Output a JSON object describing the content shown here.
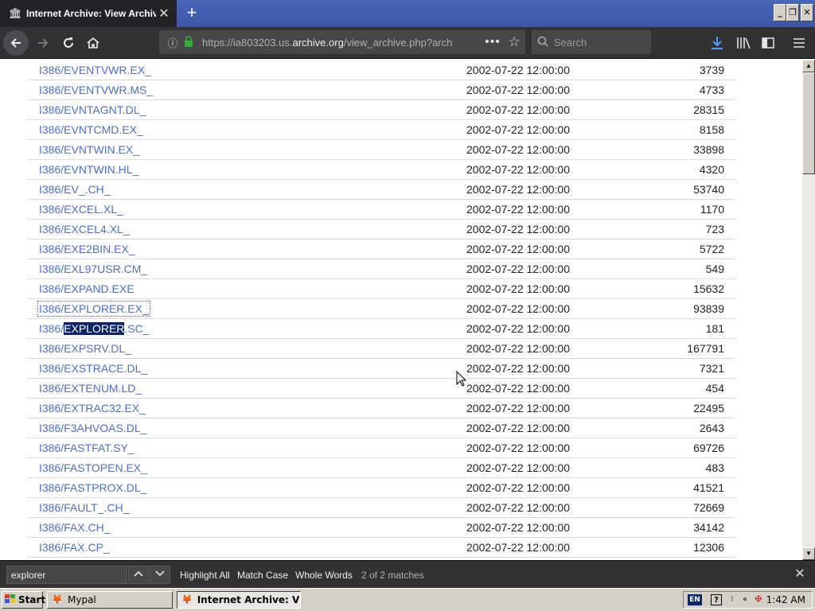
{
  "browser": {
    "tab_title": "Internet Archive: View Archive",
    "tab_close": "✕",
    "new_tab": "+",
    "url_prefix": "https://ia803203.us.",
    "url_domain": "archive.org",
    "url_suffix": "/view_archive.php?arch",
    "search_placeholder": "Search"
  },
  "window_buttons": [
    "_",
    "❐",
    "✕"
  ],
  "files": [
    {
      "name": "I386/EVENTVWR.EX_",
      "date": "2002-07-22 12:00:00",
      "size": "3739"
    },
    {
      "name": "I386/EVENTVWR.MS_",
      "date": "2002-07-22 12:00:00",
      "size": "4733"
    },
    {
      "name": "I386/EVNTAGNT.DL_",
      "date": "2002-07-22 12:00:00",
      "size": "28315"
    },
    {
      "name": "I386/EVNTCMD.EX_",
      "date": "2002-07-22 12:00:00",
      "size": "8158"
    },
    {
      "name": "I386/EVNTWIN.EX_",
      "date": "2002-07-22 12:00:00",
      "size": "33898"
    },
    {
      "name": "I386/EVNTWIN.HL_",
      "date": "2002-07-22 12:00:00",
      "size": "4320"
    },
    {
      "name": "I386/EV_.CH_",
      "date": "2002-07-22 12:00:00",
      "size": "53740"
    },
    {
      "name": "I386/EXCEL.XL_",
      "date": "2002-07-22 12:00:00",
      "size": "1170"
    },
    {
      "name": "I386/EXCEL4.XL_",
      "date": "2002-07-22 12:00:00",
      "size": "723"
    },
    {
      "name": "I386/EXE2BIN.EX_",
      "date": "2002-07-22 12:00:00",
      "size": "5722"
    },
    {
      "name": "I386/EXL97USR.CM_",
      "date": "2002-07-22 12:00:00",
      "size": "549"
    },
    {
      "name": "I386/EXPAND.EXE",
      "date": "2002-07-22 12:00:00",
      "size": "15632"
    },
    {
      "name": "I386/EXPLORER.EX_",
      "date": "2002-07-22 12:00:00",
      "size": "93839",
      "focused": true
    },
    {
      "name": "I386/EXPLORER.SC_",
      "date": "2002-07-22 12:00:00",
      "size": "181",
      "highlight": "EXPLORER"
    },
    {
      "name": "I386/EXPSRV.DL_",
      "date": "2002-07-22 12:00:00",
      "size": "167791"
    },
    {
      "name": "I386/EXSTRACE.DL_",
      "date": "2002-07-22 12:00:00",
      "size": "7321"
    },
    {
      "name": "I386/EXTENUM.LD_",
      "date": "2002-07-22 12:00:00",
      "size": "454"
    },
    {
      "name": "I386/EXTRAC32.EX_",
      "date": "2002-07-22 12:00:00",
      "size": "22495"
    },
    {
      "name": "I386/F3AHVOAS.DL_",
      "date": "2002-07-22 12:00:00",
      "size": "2643"
    },
    {
      "name": "I386/FASTFAT.SY_",
      "date": "2002-07-22 12:00:00",
      "size": "69726"
    },
    {
      "name": "I386/FASTOPEN.EX_",
      "date": "2002-07-22 12:00:00",
      "size": "483"
    },
    {
      "name": "I386/FASTPROX.DL_",
      "date": "2002-07-22 12:00:00",
      "size": "41521"
    },
    {
      "name": "I386/FAULT_.CH_",
      "date": "2002-07-22 12:00:00",
      "size": "72669"
    },
    {
      "name": "I386/FAX.CH_",
      "date": "2002-07-22 12:00:00",
      "size": "34142"
    },
    {
      "name": "I386/FAX.CP_",
      "date": "2002-07-22 12:00:00",
      "size": "12306"
    }
  ],
  "findbar": {
    "query": "explorer",
    "highlight_all": "Highlight All",
    "match_case": "Match Case",
    "whole_words": "Whole Words",
    "status": "2 of 2 matches"
  },
  "taskbar": {
    "start": "Start",
    "tasks": [
      "Mypal",
      "Internet Archive: Vie..."
    ],
    "lang": "EN",
    "clock": "1:42 AM"
  },
  "colors": {
    "link": "#4f6fc8",
    "highlight": "#0a246a",
    "toolbar": "#323234"
  }
}
